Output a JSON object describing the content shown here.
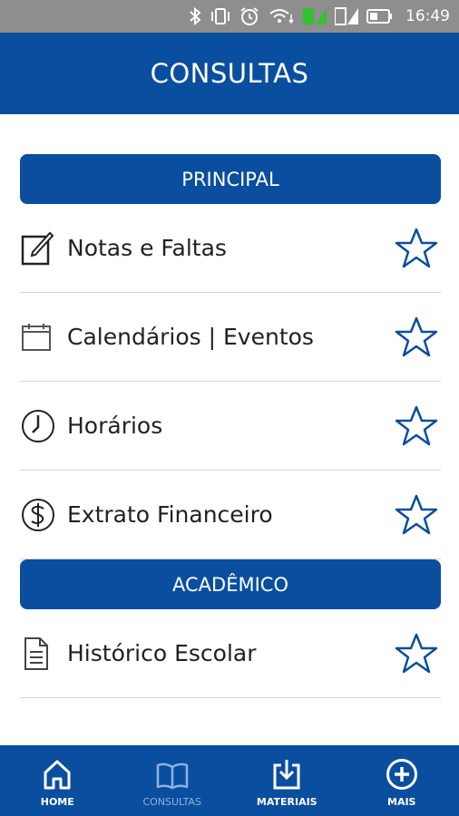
{
  "status_bar": {
    "time": "16:49"
  },
  "header": {
    "title": "CONSULTAS"
  },
  "sections": [
    {
      "title": "PRINCIPAL",
      "items": [
        {
          "label": "Notas e Faltas",
          "icon": "edit-note-icon"
        },
        {
          "label": "Calendários | Eventos",
          "icon": "calendar-icon"
        },
        {
          "label": "Horários",
          "icon": "clock-icon"
        },
        {
          "label": "Extrato Financeiro",
          "icon": "dollar-icon"
        }
      ]
    },
    {
      "title": "ACADÊMICO",
      "items": [
        {
          "label": "Histórico Escolar",
          "icon": "document-icon"
        }
      ]
    }
  ],
  "bottom_nav": [
    {
      "label": "HOME",
      "icon": "home-icon",
      "active": false
    },
    {
      "label": "CONSULTAS",
      "icon": "book-icon",
      "active": true
    },
    {
      "label": "MATERIAIS",
      "icon": "download-icon",
      "active": false
    },
    {
      "label": "MAIS",
      "icon": "plus-circle-icon",
      "active": false
    }
  ],
  "colors": {
    "primary": "#0a4ea0",
    "status_bar": "#8e8e8e",
    "star_outline": "#0a4ea0",
    "nav_active": "#8fb2dd"
  }
}
